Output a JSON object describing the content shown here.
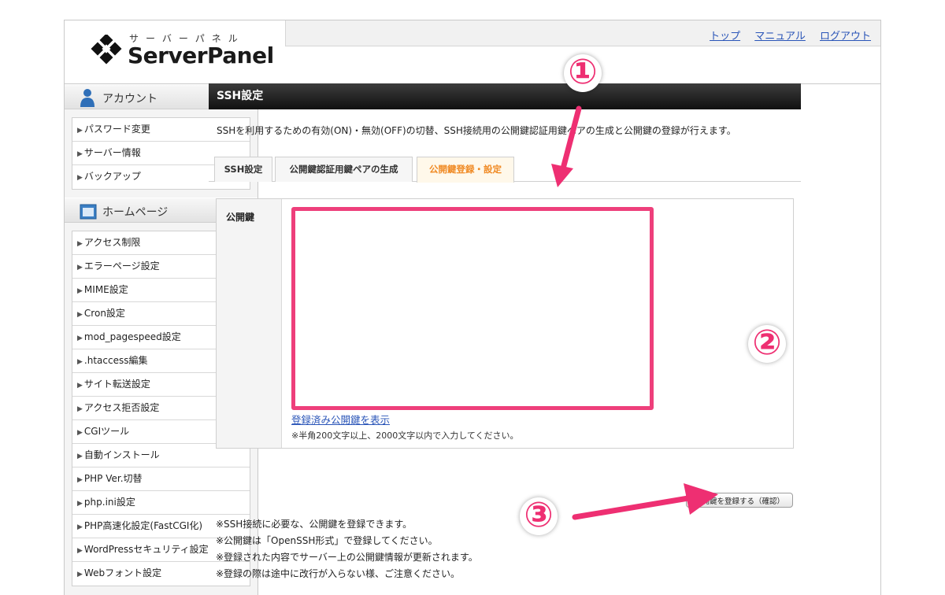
{
  "app": {
    "logo_kana": "サーバーパネル",
    "logo_text": "ServerPanel"
  },
  "header": {
    "links": [
      "トップ",
      "マニュアル",
      "ログアウト"
    ]
  },
  "sidebar": {
    "account": {
      "title": "アカウント",
      "items": [
        "パスワード変更",
        "サーバー情報",
        "バックアップ"
      ]
    },
    "homepage": {
      "title": "ホームページ",
      "items": [
        "アクセス制限",
        "エラーページ設定",
        "MIME設定",
        "Cron設定",
        "mod_pagespeed設定",
        ".htaccess編集",
        "サイト転送設定",
        "アクセス拒否設定",
        "CGIツール",
        "自動インストール",
        "PHP Ver.切替",
        "php.ini設定",
        "PHP高速化設定(FastCGI化)",
        "WordPressセキュリティ設定",
        "Webフォント設定"
      ]
    }
  },
  "main": {
    "title": "SSH設定",
    "description": "SSHを利用するための有効(ON)・無効(OFF)の切替、SSH接続用の公開鍵認証用鍵ペアの生成と公開鍵の登録が行えます。",
    "tabs": [
      "SSH設定",
      "公開鍵認証用鍵ペアの生成",
      "公開鍵登録・設定"
    ],
    "active_tab": "公開鍵登録・設定",
    "form": {
      "label": "公開鍵",
      "value": "",
      "show_link": "登録済み公開鍵を表示",
      "hint": "※半角200文字以上、2000文字以内で入力してください。"
    },
    "submit_label": "公開鍵を登録する（確認）",
    "notes": [
      "※SSH接続に必要な、公開鍵を登録できます。",
      "※公開鍵は「OpenSSH形式」で登録してください。",
      "※登録された内容でサーバー上の公開鍵情報が更新されます。",
      "※登録の際は途中に改行が入らない様、ご注意ください。"
    ]
  },
  "annotations": {
    "badge_1": "①",
    "badge_2": "②",
    "badge_3": "③",
    "color": "#ee2f72"
  },
  "colors": {
    "accent_orange": "#f08a24",
    "link_blue": "#2a55b8",
    "highlight_pink": "#ee3f7b"
  }
}
